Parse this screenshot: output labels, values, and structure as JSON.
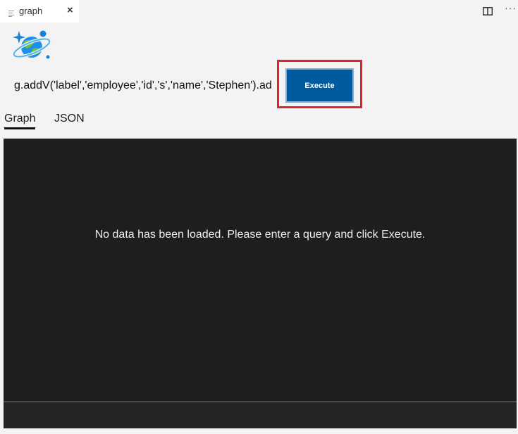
{
  "tab": {
    "title": "graph",
    "close": "×"
  },
  "editor_actions": {
    "more": "···"
  },
  "query": {
    "value": "g.addV('label','employee','id','s','name','Stephen').ad"
  },
  "execute_button": {
    "label": "Execute"
  },
  "view_tabs": [
    {
      "label": "Graph",
      "active": true
    },
    {
      "label": "JSON",
      "active": false
    }
  ],
  "canvas": {
    "message": "No data has been loaded. Please enter a query and click Execute."
  },
  "icons": {
    "logo": "cosmos-db-planet-icon",
    "file": "file-lines-icon",
    "split": "split-editor-icon"
  },
  "colors": {
    "execute_bg": "#005a9e",
    "highlight": "#e3202b",
    "canvas_bg": "#1e1e1e"
  }
}
